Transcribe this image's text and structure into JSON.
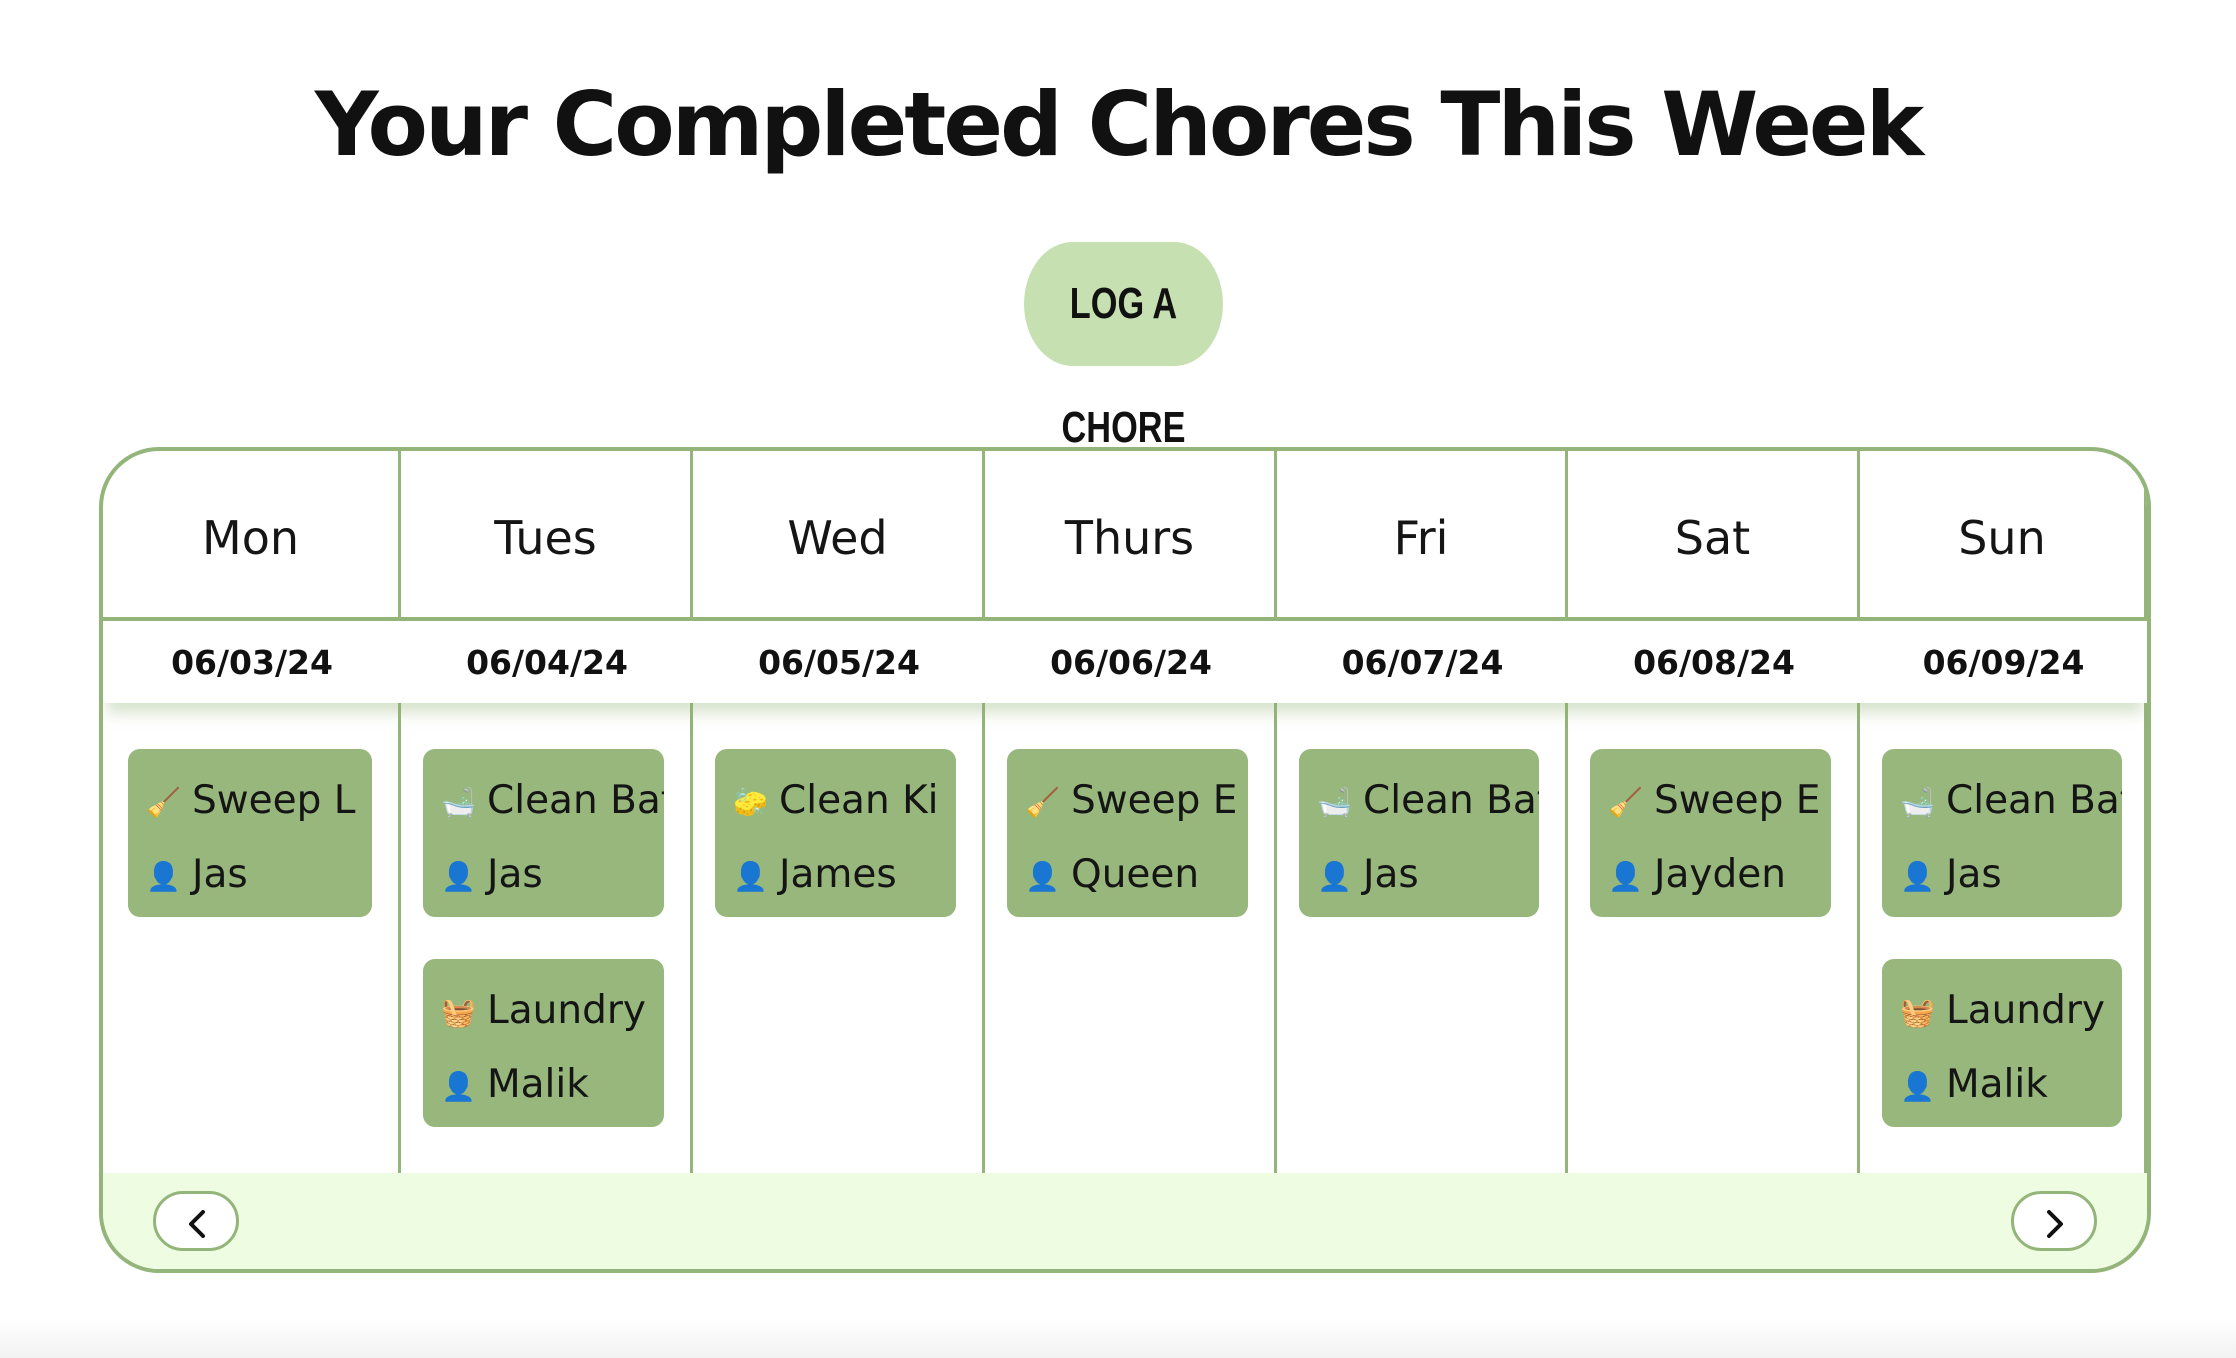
{
  "header": {
    "title": "Your Completed Chores This Week",
    "log_button_label": "LOG A CHORE"
  },
  "calendar": {
    "days": [
      {
        "name": "Mon",
        "date": "06/03/24",
        "chores": [
          {
            "icon": "broom",
            "chore": "Sweep L",
            "person": "Jas"
          }
        ]
      },
      {
        "name": "Tues",
        "date": "06/04/24",
        "chores": [
          {
            "icon": "bathtub",
            "chore": "Clean Bath",
            "person": "Jas"
          },
          {
            "icon": "basket",
            "chore": "Laundry",
            "person": "Malik"
          }
        ]
      },
      {
        "name": "Wed",
        "date": "06/05/24",
        "chores": [
          {
            "icon": "sponge",
            "chore": "Clean Ki",
            "person": "James"
          }
        ]
      },
      {
        "name": "Thurs",
        "date": "06/06/24",
        "chores": [
          {
            "icon": "broom",
            "chore": "Sweep E",
            "person": "Queen"
          }
        ]
      },
      {
        "name": "Fri",
        "date": "06/07/24",
        "chores": [
          {
            "icon": "bathtub",
            "chore": "Clean Bath",
            "person": "Jas"
          }
        ]
      },
      {
        "name": "Sat",
        "date": "06/08/24",
        "chores": [
          {
            "icon": "broom",
            "chore": "Sweep E",
            "person": "Jayden"
          }
        ]
      },
      {
        "name": "Sun",
        "date": "06/09/24",
        "chores": [
          {
            "icon": "bathtub",
            "chore": "Clean Bath",
            "person": "Jas"
          },
          {
            "icon": "basket",
            "chore": "Laundry",
            "person": "Malik"
          }
        ]
      }
    ],
    "nav": {
      "prev_icon": "chevron-left-icon",
      "next_icon": "chevron-right-icon"
    }
  },
  "icons": {
    "broom": "🧹",
    "bathtub": "🛁",
    "basket": "🧺",
    "sponge": "🧽",
    "person": "👤"
  },
  "colors": {
    "accent_green": "#93b57a",
    "card_green": "#97b77c",
    "button_green": "#c7e0b2",
    "footer_bg": "#eefce1"
  }
}
